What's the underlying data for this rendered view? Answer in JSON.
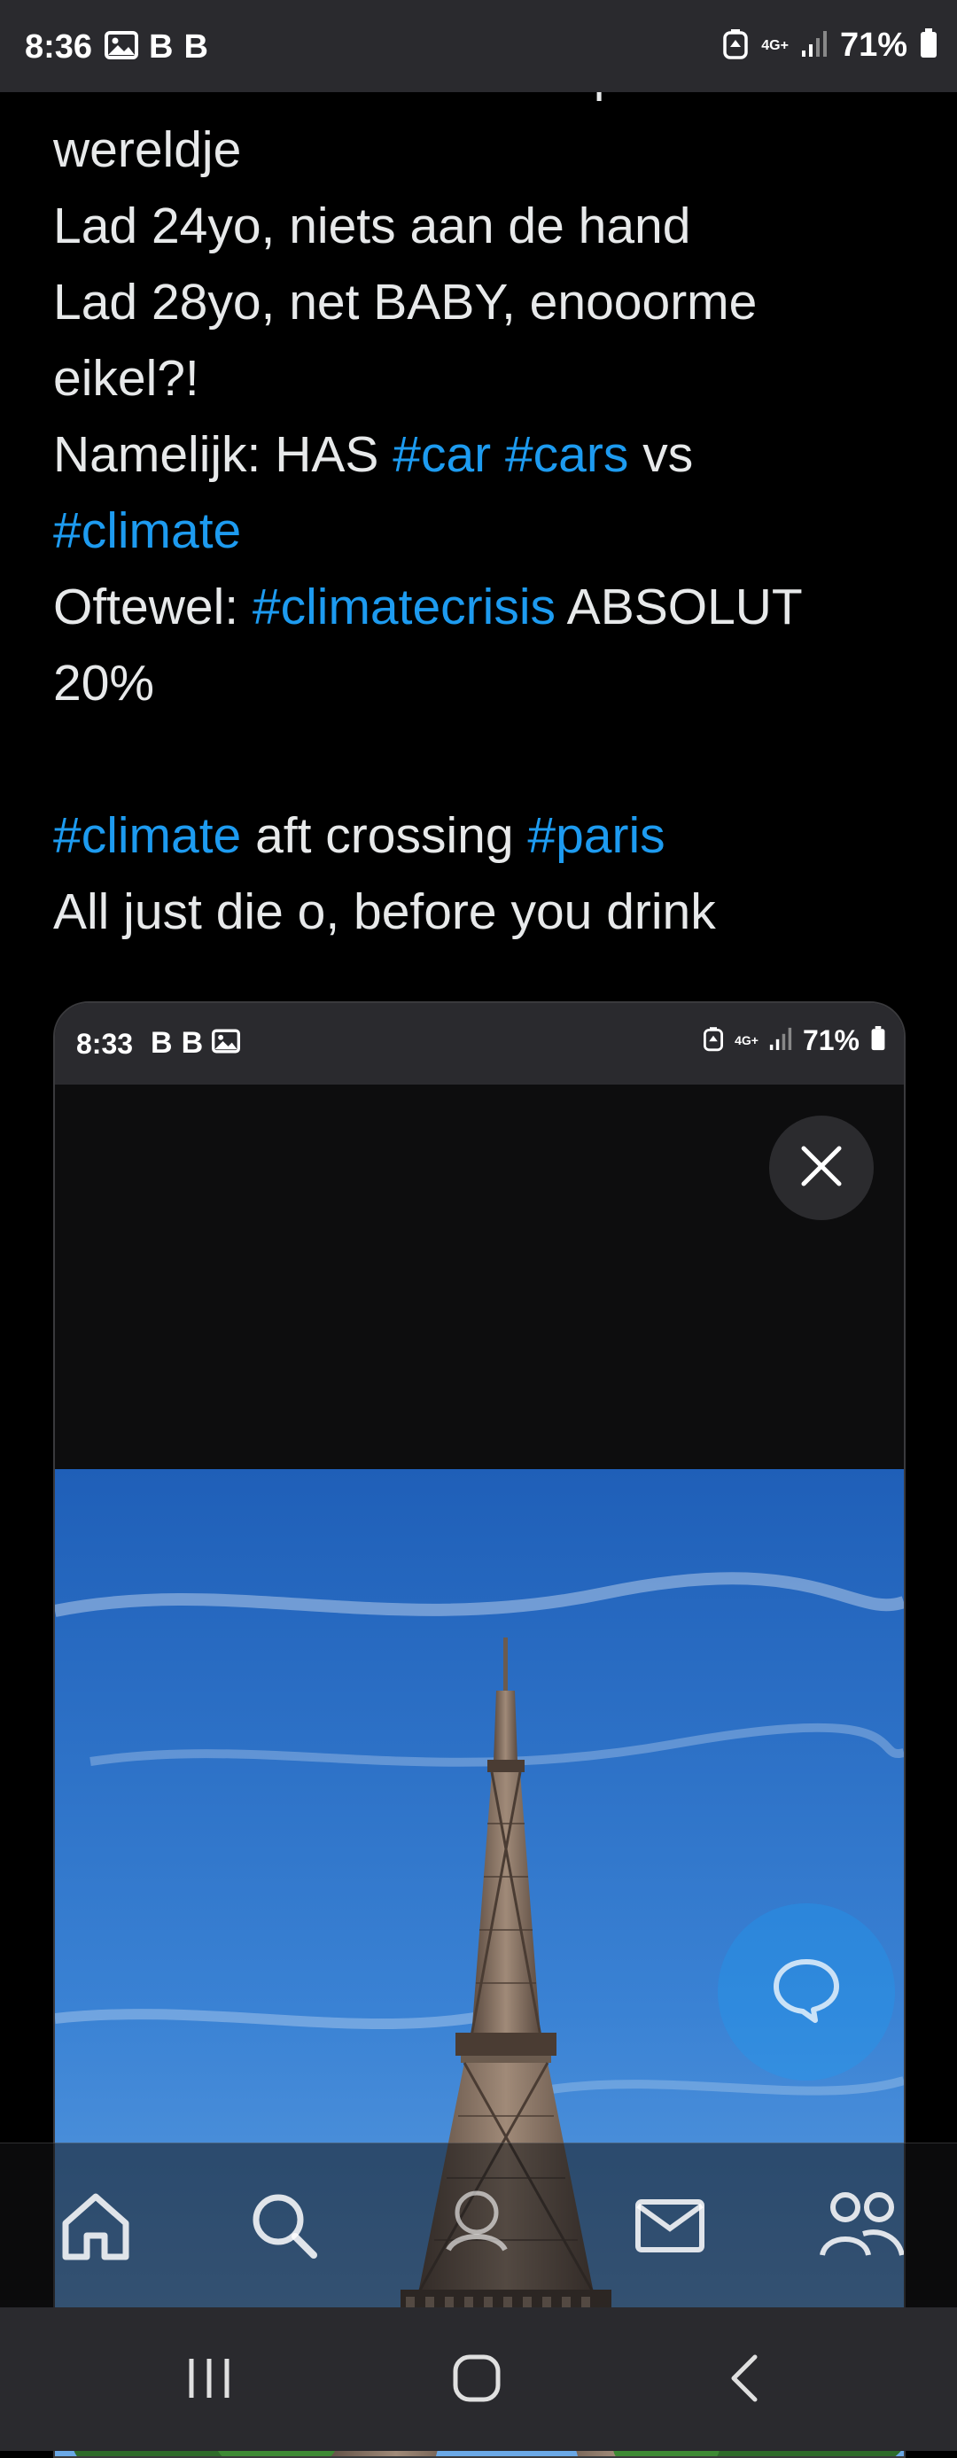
{
  "status_bar": {
    "time": "8:36",
    "b1": "B",
    "b2": "B",
    "network": "4G+",
    "battery": "71%"
  },
  "tweet": {
    "lines": [
      [
        {
          "t": "Auto's net als Arabic... apart",
          "tag": false
        }
      ],
      [
        {
          "t": "wereldje",
          "tag": false
        }
      ],
      [
        {
          "t": "Lad 24yo, niets aan de hand",
          "tag": false
        }
      ],
      [
        {
          "t": "Lad 28yo, net BABY, enooorme",
          "tag": false
        }
      ],
      [
        {
          "t": "eikel?!",
          "tag": false
        }
      ],
      [
        {
          "t": "Namelijk: HAS ",
          "tag": false
        },
        {
          "t": "#car",
          "tag": true
        },
        {
          "t": " ",
          "tag": false
        },
        {
          "t": "#cars",
          "tag": true
        },
        {
          "t": " vs",
          "tag": false
        }
      ],
      [
        {
          "t": "#climate",
          "tag": true
        }
      ],
      [
        {
          "t": "Oftewel: ",
          "tag": false
        },
        {
          "t": "#climatecrisis",
          "tag": true
        },
        {
          "t": " ABSOLUT",
          "tag": false
        }
      ],
      [
        {
          "t": "20%",
          "tag": false
        }
      ],
      [
        {
          "t": "",
          "tag": false
        }
      ],
      [
        {
          "t": "#climate",
          "tag": true
        },
        {
          "t": " aft crossing ",
          "tag": false
        },
        {
          "t": "#paris",
          "tag": true
        }
      ],
      [
        {
          "t": "All just die o, before you drink",
          "tag": false
        }
      ]
    ]
  },
  "media": {
    "status_bar": {
      "time": "8:33",
      "b1": "B",
      "b2": "B",
      "network": "4G+",
      "battery": "71%"
    },
    "close_icon": "close-icon",
    "photo_subject": "eiffel-tower-photo"
  },
  "bottom_nav": {
    "items": [
      "home-icon",
      "search-icon",
      "communities-icon",
      "messages-icon",
      "people-icon"
    ]
  },
  "system_nav": {
    "items": [
      "recent-apps-icon",
      "home-button-icon",
      "back-icon"
    ]
  },
  "colors": {
    "hashtag": "#1d9bf0",
    "background": "#000000",
    "text": "#e7e9ea",
    "sky": "#2f6fc0"
  }
}
